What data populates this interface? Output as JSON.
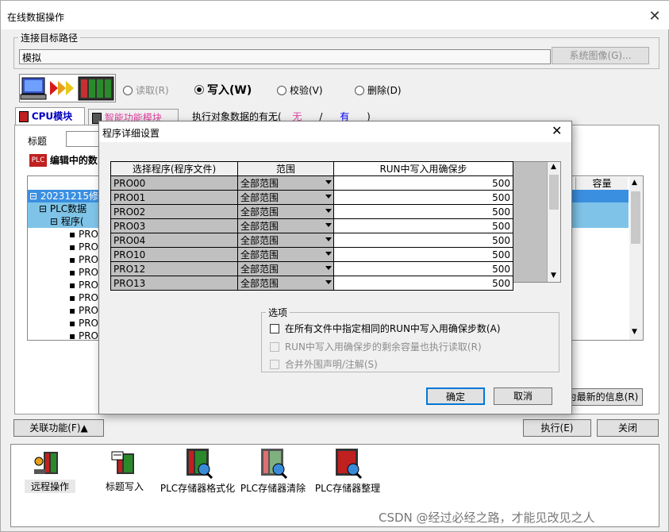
{
  "window": {
    "title": "在线数据操作"
  },
  "connection": {
    "legend": "连接目标路径",
    "value": "模拟",
    "system_image_button": "系统图像(G)..."
  },
  "mode": {
    "read": "读取(R)",
    "write": "写入(W)",
    "verify": "校验(V)",
    "delete": "删除(D)",
    "selected": "write"
  },
  "tabs": {
    "cpu": "CPU模块",
    "smart": "智能功能模块"
  },
  "exec_target": {
    "label": "执行对象数据的有无(",
    "none": "无",
    "slash": "/",
    "have": "有",
    "close_paren": ")"
  },
  "main_panel": {
    "title_label": "标题",
    "editing_label": "编辑中的数",
    "capacity_header": "容量",
    "latest_info_button": "为最新的信息(R)"
  },
  "tree": {
    "rows": [
      "20231215修",
      "PLC数据",
      "程序(",
      "PRO",
      "PRO",
      "PRO",
      "PRO",
      "PRO",
      "PRO",
      "PRO",
      "PRO",
      "PRO"
    ]
  },
  "footer": {
    "related_button": "关联功能(F)▲",
    "execute_button": "执行(E)",
    "close_button": "关闭"
  },
  "bottom_tools": [
    {
      "label": "远程操作",
      "icon": "remote-operation-icon"
    },
    {
      "label": "标题写入",
      "icon": "title-write-icon"
    },
    {
      "label": "PLC存储器格式化",
      "icon": "plc-memory-format-icon"
    },
    {
      "label": "PLC存储器清除",
      "icon": "plc-memory-clear-icon"
    },
    {
      "label": "PLC存储器整理",
      "icon": "plc-memory-arrange-icon"
    }
  ],
  "watermark": "CSDN @经过必经之路，才能见改见之人",
  "dialog": {
    "title": "程序详细设置",
    "columns": [
      "选择程序(程序文件)",
      "范围",
      "RUN中写入用确保步"
    ],
    "rows": [
      {
        "program": "PRO00",
        "range": "全部范围",
        "steps": "500"
      },
      {
        "program": "PRO01",
        "range": "全部范围",
        "steps": "500"
      },
      {
        "program": "PRO02",
        "range": "全部范围",
        "steps": "500"
      },
      {
        "program": "PRO03",
        "range": "全部范围",
        "steps": "500"
      },
      {
        "program": "PRO04",
        "range": "全部范围",
        "steps": "500"
      },
      {
        "program": "PRO10",
        "range": "全部范围",
        "steps": "500"
      },
      {
        "program": "PRO12",
        "range": "全部范围",
        "steps": "500"
      },
      {
        "program": "PRO13",
        "range": "全部范围",
        "steps": "500"
      }
    ],
    "options": {
      "legend": "选项",
      "opt1": "在所有文件中指定相同的RUN中写入用确保步数(A)",
      "opt2": "RUN中写入用确保步的剩余容量也执行读取(R)",
      "opt3": "合并外围声明/注解(S)"
    },
    "ok_button": "确定",
    "cancel_button": "取消"
  },
  "colors": {
    "accent_pink": "#e040a0",
    "accent_blue": "#0000ff",
    "selection": "#7fc4e8"
  }
}
